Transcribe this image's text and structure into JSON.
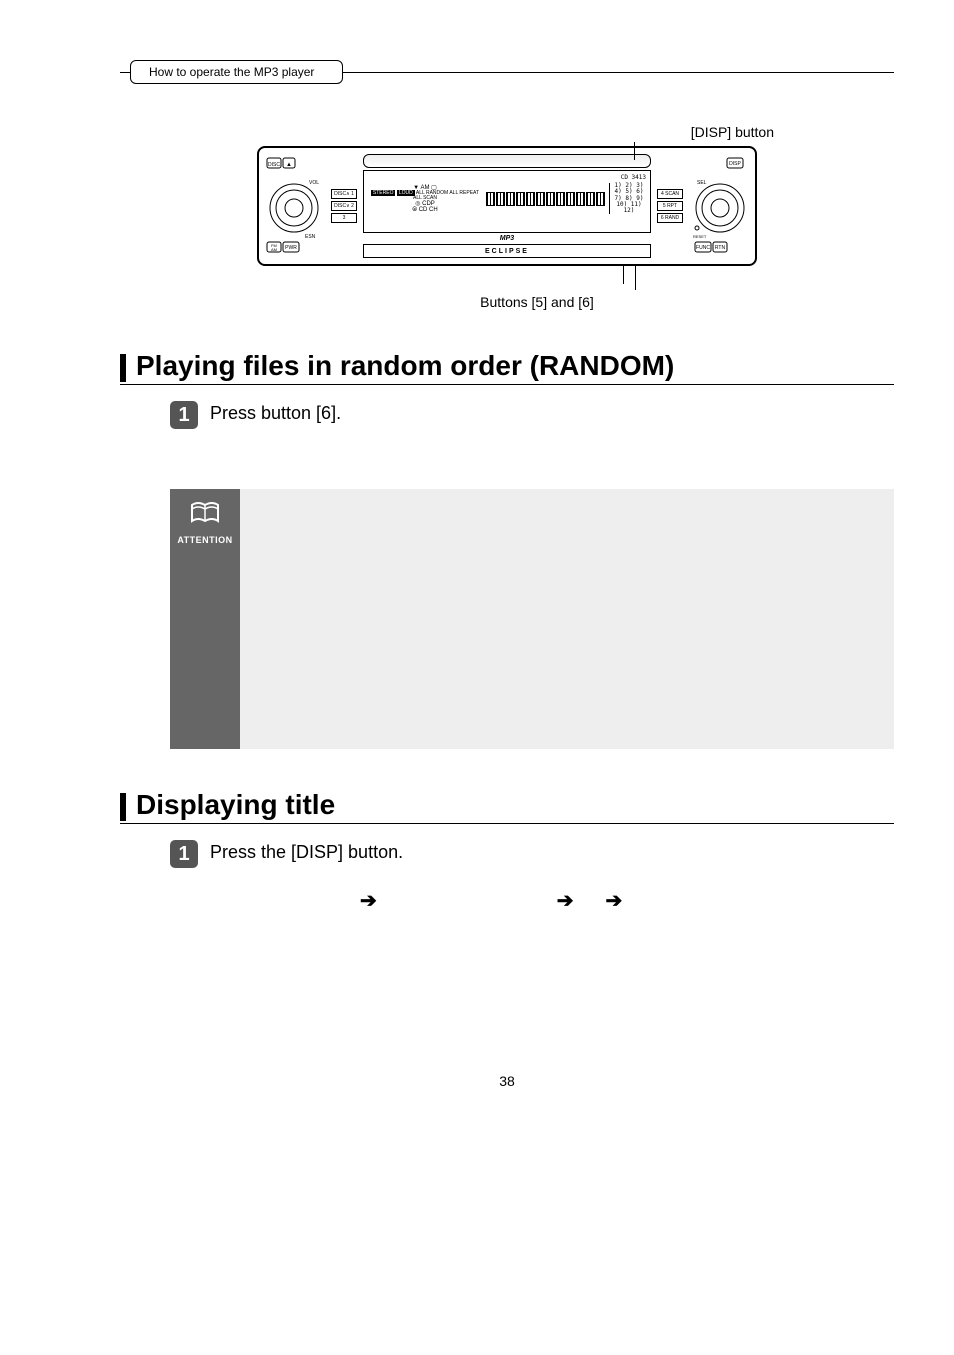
{
  "breadcrumb": "How to operate the MP3 player",
  "device": {
    "callout_top": "[DISP] button",
    "callout_bottom": "Buttons [5] and [6]",
    "model": "CD 3413",
    "brand": "ECLIPSE",
    "mp3_label": "MP3",
    "lcd_indicators": "ALL RANDOM ALL REPEAT ALL SCAN",
    "lcd_left_icons_line1": "AM",
    "lcd_left_icons_line2": "CDP",
    "lcd_left_icons_line3": "CD CH",
    "preset_rows": [
      "1) 2) 3)",
      "4) 5) 6)",
      "7) 8) 9)",
      "10) 11) 12)"
    ],
    "left_side_buttons": [
      "DISC∧ 1",
      "DISC∨ 2",
      "3"
    ],
    "right_side_buttons": [
      "4 SCAN",
      "5 RPT",
      "6 RAND"
    ],
    "left_knob_labels": {
      "top": "VOL",
      "bottom_left": "FM AM",
      "bottom_right": "PWR",
      "side": "ESN"
    },
    "right_knob_labels": {
      "top": "SEL",
      "bottom_left": "FUNC",
      "bottom_mid": "RTN",
      "side": "RESET"
    },
    "corner_buttons": {
      "tl": "DISC",
      "tl2": "▲",
      "tr": "DISP"
    }
  },
  "section1": {
    "title": "Playing files in random order (RANDOM)",
    "step1_num": "1",
    "step1_text": "Press button [6]."
  },
  "attention_label": "ATTENTION",
  "section2": {
    "title": "Displaying title",
    "step1_num": "1",
    "step1_text": "Press the [DISP] button."
  },
  "arrows": {
    "a1": "➔",
    "a2": "➔",
    "a3": "➔"
  },
  "page_number": "38"
}
